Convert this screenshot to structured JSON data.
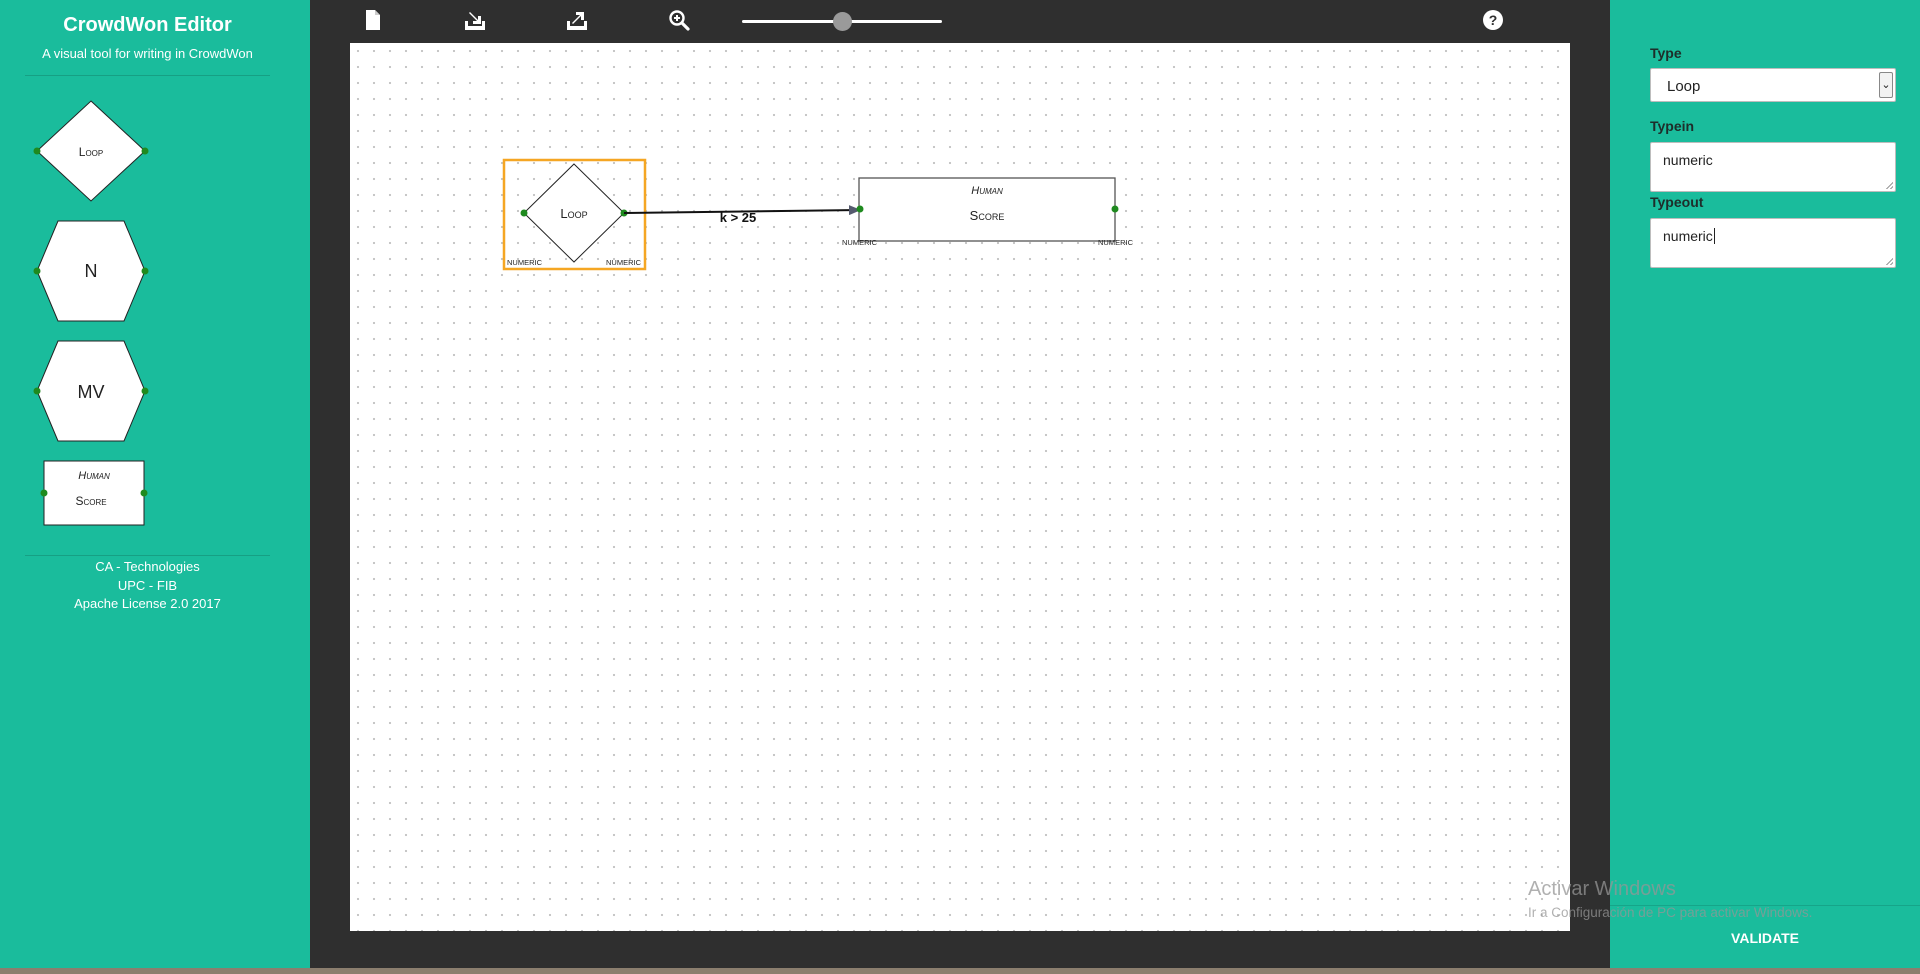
{
  "sidebar": {
    "title": "CrowdWon Editor",
    "subtitle": "A visual tool for writing in CrowdWon",
    "palette": [
      {
        "name": "loop",
        "label": "Loop"
      },
      {
        "name": "n",
        "label": "N"
      },
      {
        "name": "mv",
        "label": "MV"
      },
      {
        "name": "human-score",
        "top": "Human",
        "label": "Score"
      }
    ],
    "footer": [
      "CA - Technologies",
      "UPC - FIB",
      "Apache License 2.0 2017"
    ]
  },
  "toolbar": {
    "icons": [
      "new-file-icon",
      "import-icon",
      "export-icon",
      "zoom-in-icon",
      "help-icon"
    ],
    "zoom_level": 0.5
  },
  "diagram": {
    "nodes": [
      {
        "id": "loop",
        "label": "Loop",
        "port_in": "NUMERIC",
        "port_out": "NUMERIC",
        "selected": true
      },
      {
        "id": "human-score",
        "top": "Human",
        "label": "Score",
        "port_in": "NUMERIC",
        "port_out": "NUMERIC",
        "selected": false
      }
    ],
    "edges": [
      {
        "from": "loop",
        "to": "human-score",
        "label": "k > 25"
      }
    ]
  },
  "properties": {
    "type_label": "Type",
    "type_value": "Loop",
    "typein_label": "Typein",
    "typein_value": "numeric",
    "typeout_label": "Typeout",
    "typeout_value": "numeric",
    "validate_label": "VALIDATE"
  },
  "watermark": {
    "title": "Activar Windows",
    "subtitle": "Ir a Configuración de PC para activar Windows."
  },
  "colors": {
    "accent": "#1abc9c",
    "workspace": "#2f2f2f",
    "selection": "#f5a623",
    "port": "#1f8a1f"
  }
}
